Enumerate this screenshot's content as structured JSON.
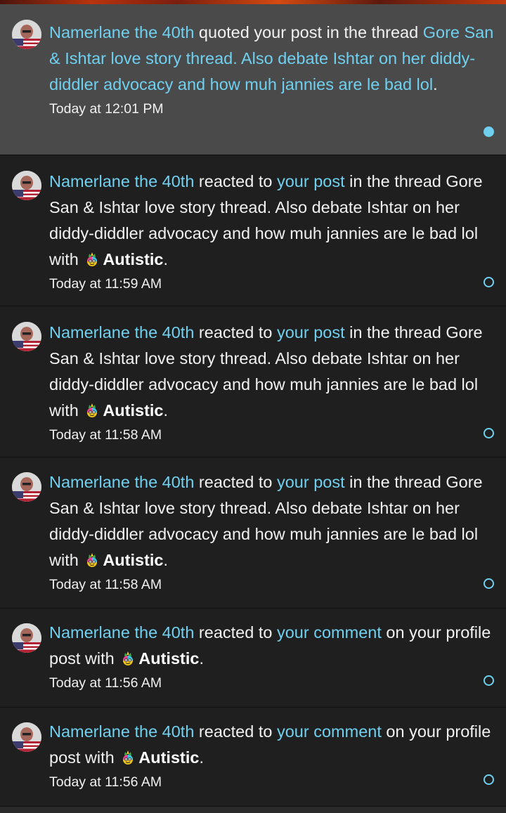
{
  "colors": {
    "link": "#6fd0f0",
    "unread_bg": "#4a4a4a",
    "read_bg": "#1f1f1f",
    "text": "#f1f1f1"
  },
  "notifications": [
    {
      "user": "Namerlane the 40th",
      "action": " quoted your post in the thread ",
      "target": "",
      "thread": "Gore San & Ishtar love story thread. Also debate Ishtar on her diddy-diddler advocacy and how muh jannies are le bad lol",
      "suffix": ".",
      "reaction": "",
      "time": "Today at 12:01 PM",
      "status": "unread"
    },
    {
      "user": "Namerlane the 40th",
      "action": " reacted to ",
      "target": "your post",
      "mid": " in the thread Gore San & Ishtar love story thread. Also debate Ishtar on her diddy-diddler advocacy and how muh jannies are le bad lol with ",
      "reaction": "Autistic",
      "reaction_icon": "autistic-reaction-icon",
      "suffix": ".",
      "time": "Today at 11:59 AM",
      "status": "read"
    },
    {
      "user": "Namerlane the 40th",
      "action": " reacted to ",
      "target": "your post",
      "mid": " in the thread Gore San & Ishtar love story thread. Also debate Ishtar on her diddy-diddler advocacy and how muh jannies are le bad lol with ",
      "reaction": "Autistic",
      "reaction_icon": "autistic-reaction-icon",
      "suffix": ".",
      "time": "Today at 11:58 AM",
      "status": "read"
    },
    {
      "user": "Namerlane the 40th",
      "action": " reacted to ",
      "target": "your post",
      "mid": " in the thread Gore San & Ishtar love story thread. Also debate Ishtar on her diddy-diddler advocacy and how muh jannies are le bad lol with ",
      "reaction": "Autistic",
      "reaction_icon": "autistic-reaction-icon",
      "suffix": ".",
      "time": "Today at 11:58 AM",
      "status": "read"
    },
    {
      "user": "Namerlane the 40th",
      "action": " reacted to ",
      "target": "your comment",
      "mid": " on your profile post with ",
      "reaction": "Autistic",
      "reaction_icon": "autistic-reaction-icon",
      "suffix": ".",
      "time": "Today at 11:56 AM",
      "status": "read"
    },
    {
      "user": "Namerlane the 40th",
      "action": " reacted to ",
      "target": "your comment",
      "mid": " on your profile post with ",
      "reaction": "Autistic",
      "reaction_icon": "autistic-reaction-icon",
      "suffix": ".",
      "time": "Today at 11:56 AM",
      "status": "read"
    }
  ]
}
